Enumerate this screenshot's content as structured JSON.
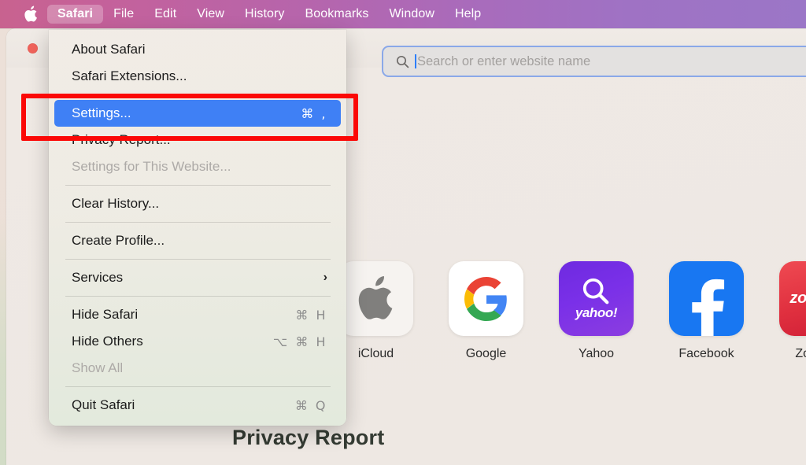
{
  "menubar": {
    "apple_icon": "apple-logo-icon",
    "items": [
      {
        "label": "Safari",
        "active": true
      },
      {
        "label": "File",
        "active": false
      },
      {
        "label": "Edit",
        "active": false
      },
      {
        "label": "View",
        "active": false
      },
      {
        "label": "History",
        "active": false
      },
      {
        "label": "Bookmarks",
        "active": false
      },
      {
        "label": "Window",
        "active": false
      },
      {
        "label": "Help",
        "active": false
      }
    ]
  },
  "window": {
    "close_button": "close-window-button",
    "search": {
      "placeholder": "Search or enter website name",
      "value": "",
      "icon": "search-icon"
    }
  },
  "menu": {
    "title": "Safari",
    "items": [
      {
        "label": "About Safari",
        "shortcut": "",
        "state": "normal",
        "type": "item"
      },
      {
        "label": "Safari Extensions...",
        "shortcut": "",
        "state": "normal",
        "type": "item"
      },
      {
        "type": "separator"
      },
      {
        "label": "Settings...",
        "shortcut": "⌘ ,",
        "state": "selected",
        "type": "item"
      },
      {
        "label": "Privacy Report...",
        "shortcut": "",
        "state": "normal",
        "type": "item"
      },
      {
        "label": "Settings for This Website...",
        "shortcut": "",
        "state": "disabled",
        "type": "item"
      },
      {
        "type": "separator"
      },
      {
        "label": "Clear History...",
        "shortcut": "",
        "state": "normal",
        "type": "item"
      },
      {
        "type": "separator"
      },
      {
        "label": "Create Profile...",
        "shortcut": "",
        "state": "normal",
        "type": "item"
      },
      {
        "type": "separator"
      },
      {
        "label": "Services",
        "shortcut": "",
        "state": "normal",
        "type": "submenu",
        "chevron": "›"
      },
      {
        "type": "separator"
      },
      {
        "label": "Hide Safari",
        "shortcut": "⌘ H",
        "state": "normal",
        "type": "item"
      },
      {
        "label": "Hide Others",
        "shortcut": "⌥ ⌘ H",
        "state": "normal",
        "type": "item"
      },
      {
        "label": "Show All",
        "shortcut": "",
        "state": "disabled",
        "type": "item"
      },
      {
        "type": "separator"
      },
      {
        "label": "Quit Safari",
        "shortcut": "⌘ Q",
        "state": "normal",
        "type": "item"
      }
    ]
  },
  "favorites": [
    {
      "label": "iCloud",
      "icon": "apple-logo-icon",
      "tile": "t-icloud"
    },
    {
      "label": "Google",
      "icon": "google-g-icon",
      "tile": "t-google"
    },
    {
      "label": "Yahoo",
      "icon": "yahoo-search-icon",
      "tile": "t-yahoo",
      "wordmark": "yahoo!"
    },
    {
      "label": "Facebook",
      "icon": "facebook-f-icon",
      "tile": "t-facebook"
    },
    {
      "label": "Zomato",
      "icon": "zomato-wordmark-icon",
      "tile": "t-zomato",
      "wordmark": "zomato"
    }
  ],
  "page": {
    "privacy_heading": "Privacy Report"
  },
  "annotation": {
    "name": "settings-highlight-box",
    "color": "#FB0806"
  },
  "colors": {
    "menubar_start": "#C8628F",
    "menubar_end": "#9B76C7",
    "selection_blue": "#3F80F5",
    "focus_ring": "#8AA8E8",
    "annotation_red": "#FB0806",
    "wallpaper_warm": "#ECE0D8",
    "wallpaper_green": "#CFDCC4",
    "wallpaper_lilac": "#E4DEE8"
  }
}
